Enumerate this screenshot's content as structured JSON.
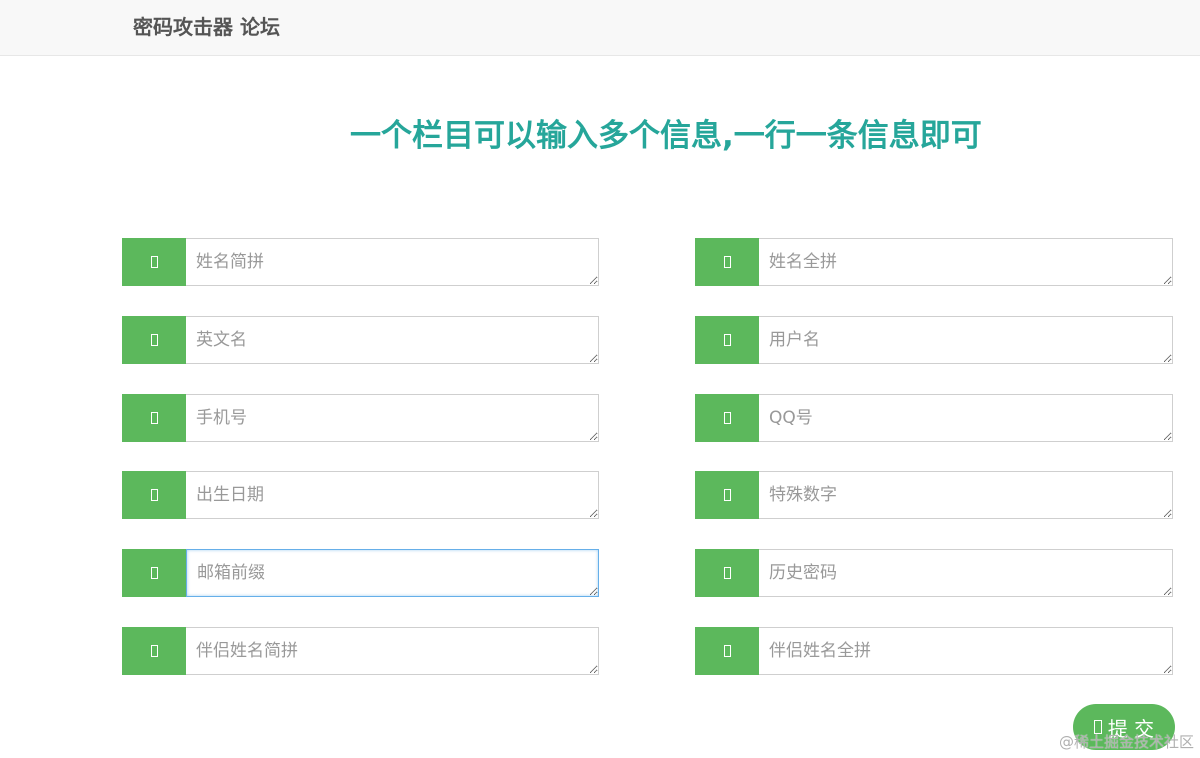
{
  "header": {
    "brand": "密码攻击器 论坛"
  },
  "main": {
    "heading": "一个栏目可以输入多个信息,一行一条信息即可",
    "fields_left": [
      {
        "placeholder": "姓名简拼",
        "value": ""
      },
      {
        "placeholder": "英文名",
        "value": ""
      },
      {
        "placeholder": "手机号",
        "value": ""
      },
      {
        "placeholder": "出生日期",
        "value": ""
      },
      {
        "placeholder": "邮箱前缀",
        "value": ""
      },
      {
        "placeholder": "伴侣姓名简拼",
        "value": ""
      }
    ],
    "fields_right": [
      {
        "placeholder": "姓名全拼",
        "value": ""
      },
      {
        "placeholder": "用户名",
        "value": ""
      },
      {
        "placeholder": "QQ号",
        "value": ""
      },
      {
        "placeholder": "特殊数字",
        "value": ""
      },
      {
        "placeholder": "历史密码",
        "value": ""
      },
      {
        "placeholder": "伴侣姓名全拼",
        "value": ""
      }
    ],
    "submit_label": "提 交"
  },
  "watermark": "@稀土掘金技术社区",
  "colors": {
    "accent_green": "#5cb85c",
    "heading_teal": "#26a69a",
    "focus_border": "#66afe9"
  },
  "icons": {
    "field_addon": "missing-glyph-icon",
    "submit": "missing-glyph-icon"
  }
}
